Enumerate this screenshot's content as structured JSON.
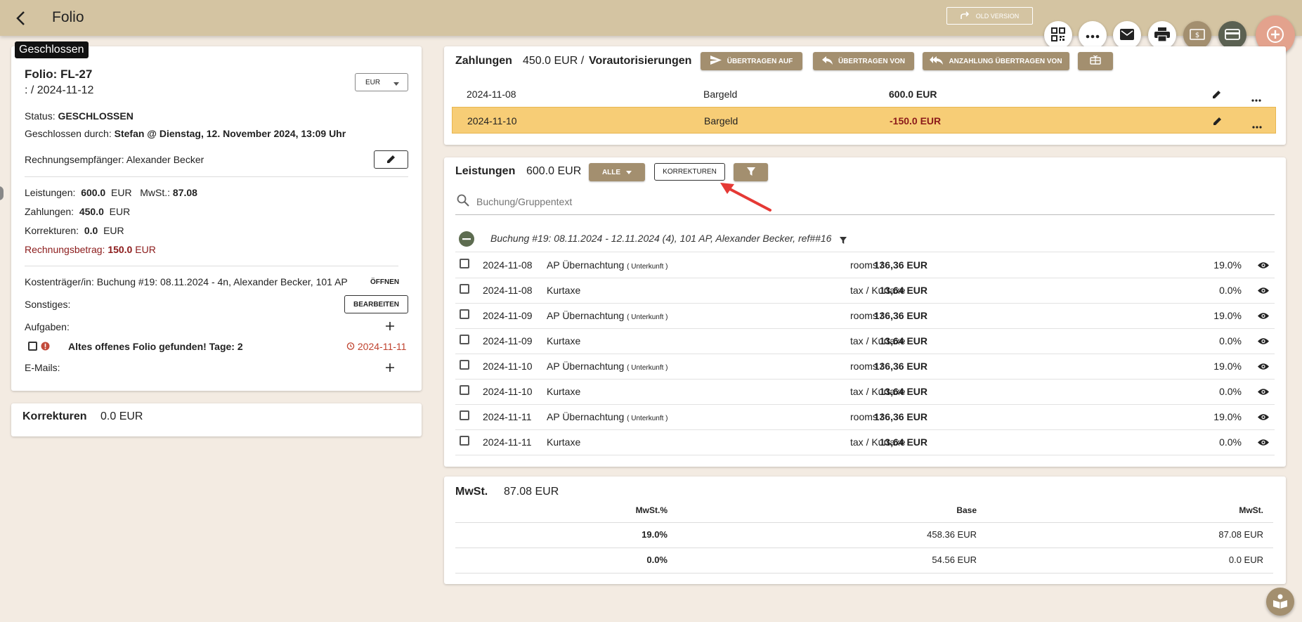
{
  "header": {
    "title": "Folio",
    "old_version_label": "OLD VERSION"
  },
  "folio": {
    "status_badge": "Geschlossen",
    "folio_label": "Folio: FL-27",
    "date_range": ": / 2024-11-12",
    "currency": "EUR",
    "status_label": "Status:",
    "status_value": "GESCHLOSSEN",
    "closed_by_label": "Geschlossen durch:",
    "closed_by_value": "Stefan @ Dienstag, 12. November 2024, 13:09 Uhr",
    "recipient_label": "Rechnungsempfänger:",
    "recipient_value": "Alexander Becker",
    "services_label": "Leistungen:",
    "services_value": "600.0",
    "services_currency": "EUR",
    "vat_label": "MwSt.:",
    "vat_value": "87.08",
    "payments_label": "Zahlungen:",
    "payments_value": "450.0",
    "payments_currency": "EUR",
    "corrections_label": "Korrekturen:",
    "corrections_value": "0.0",
    "corrections_currency": "EUR",
    "invoice_label": "Rechnungsbetrag:",
    "invoice_value": "150.0",
    "invoice_currency": "EUR",
    "cost_bearer_label": "Kostenträger/in:",
    "cost_bearer_value": "Buchung #19: 08.11.2024 - 4n, Alexander Becker, 101 AP",
    "open_label": "ÖFFNEN",
    "misc_label": "Sonstiges:",
    "edit_label": "BEARBEITEN",
    "tasks_label": "Aufgaben:",
    "task_text": "Altes offenes Folio gefunden! Tage: 2",
    "task_date": "2024-11-11",
    "emails_label": "E-Mails:"
  },
  "corrections_card": {
    "title": "Korrekturen",
    "amount": "0.0 EUR"
  },
  "payments": {
    "title": "Zahlungen",
    "amount": "450.0 EUR /",
    "preauth": "Vorautorisierungen",
    "btn_transfer_to": "ÜBERTRAGEN AUF",
    "btn_transfer_from": "ÜBERTRAGEN VON",
    "btn_deposit_from": "ANZAHLUNG ÜBERTRAGEN VON",
    "rows": [
      {
        "date": "2024-11-08",
        "method": "Bargeld",
        "amount": "600.0 EUR"
      },
      {
        "date": "2024-11-10",
        "method": "Bargeld",
        "amount": "-150.0 EUR"
      }
    ]
  },
  "services": {
    "title": "Leistungen",
    "amount": "600.0 EUR",
    "filter_all": "ALLE",
    "corrections_btn": "KORREKTUREN",
    "search_placeholder": "Buchung/Gruppentext",
    "group_label": "Buchung #19: 08.11.2024 - 12.11.2024 (4), 101 AP, Alexander Becker, ref##16",
    "rows": [
      {
        "date": "2024-11-08",
        "name": "AP Übernachtung",
        "sub": "( Unterkunft )",
        "category": "rooms /",
        "amount": "136,36 EUR",
        "vat": "19.0%"
      },
      {
        "date": "2024-11-08",
        "name": "Kurtaxe",
        "sub": "",
        "category": "tax / Kurtaxe",
        "amount": "13,64 EUR",
        "vat": "0.0%"
      },
      {
        "date": "2024-11-09",
        "name": "AP Übernachtung",
        "sub": "( Unterkunft )",
        "category": "rooms /",
        "amount": "136,36 EUR",
        "vat": "19.0%"
      },
      {
        "date": "2024-11-09",
        "name": "Kurtaxe",
        "sub": "",
        "category": "tax / Kurtaxe",
        "amount": "13,64 EUR",
        "vat": "0.0%"
      },
      {
        "date": "2024-11-10",
        "name": "AP Übernachtung",
        "sub": "( Unterkunft )",
        "category": "rooms /",
        "amount": "136,36 EUR",
        "vat": "19.0%"
      },
      {
        "date": "2024-11-10",
        "name": "Kurtaxe",
        "sub": "",
        "category": "tax / Kurtaxe",
        "amount": "13,64 EUR",
        "vat": "0.0%"
      },
      {
        "date": "2024-11-11",
        "name": "AP Übernachtung",
        "sub": "( Unterkunft )",
        "category": "rooms /",
        "amount": "136,36 EUR",
        "vat": "19.0%"
      },
      {
        "date": "2024-11-11",
        "name": "Kurtaxe",
        "sub": "",
        "category": "tax / Kurtaxe",
        "amount": "13,64 EUR",
        "vat": "0.0%"
      }
    ]
  },
  "vat": {
    "title": "MwSt.",
    "amount": "87.08 EUR",
    "col_rate": "MwSt.%",
    "col_base": "Base",
    "col_vat": "MwSt.",
    "rows": [
      {
        "rate": "19.0%",
        "base": "458.36 EUR",
        "vat": "87.08 EUR"
      },
      {
        "rate": "0.0%",
        "base": "54.56 EUR",
        "vat": "0.0 EUR"
      }
    ]
  },
  "colors": {
    "topbar": "#d4c4a2",
    "background": "#f3ebe2",
    "tan_button": "#a38f6f",
    "highlight_row": "#f7cd76",
    "negative": "#8b1a1a",
    "fab": "#e3a28d"
  }
}
